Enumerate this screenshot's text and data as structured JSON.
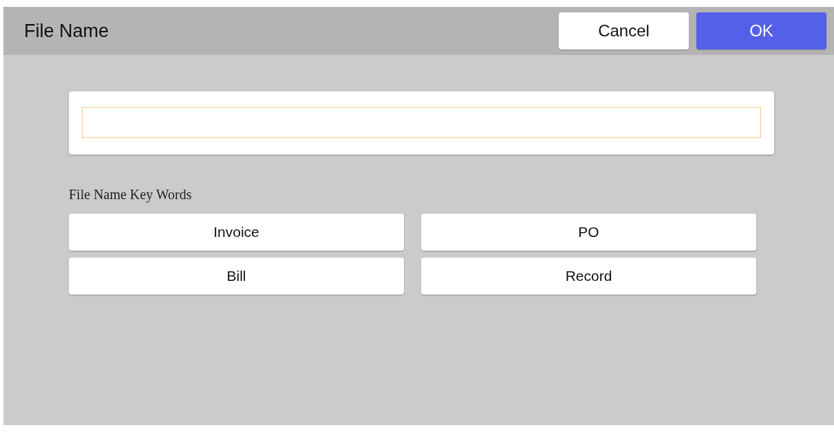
{
  "header": {
    "title": "File Name",
    "buttons": [
      {
        "label": "Cancel",
        "kind": "secondary"
      },
      {
        "label": "OK",
        "kind": "primary"
      }
    ]
  },
  "file_name_field": {
    "focused": true
  },
  "keywords": {
    "label": "File Name Key Words",
    "buttons": [
      {
        "label": "Invoice"
      },
      {
        "label": "PO"
      },
      {
        "label": "Bill"
      },
      {
        "label": "Record"
      }
    ]
  }
}
